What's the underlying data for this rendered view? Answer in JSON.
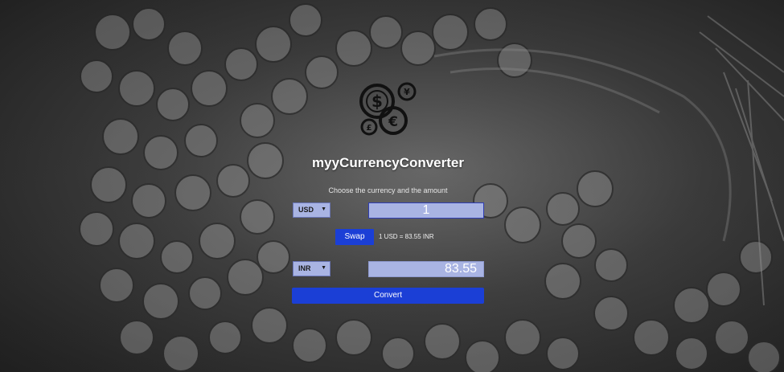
{
  "app": {
    "title": "myyCurrencyConverter",
    "subtitle": "Choose the currency and the amount"
  },
  "from": {
    "currency": "USD",
    "amount": "1"
  },
  "to": {
    "currency": "INR",
    "amount": "83.55"
  },
  "swap_label": "Swap",
  "rate_text": "1 USD = 83.55 INR",
  "convert_label": "Convert",
  "logo": {
    "icon": "currency-coins-logo",
    "symbols": [
      "$",
      "¥",
      "€",
      "£"
    ]
  },
  "colors": {
    "button": "#1b3fd6",
    "field": "#a9b4e3",
    "text": "#ffffff"
  }
}
